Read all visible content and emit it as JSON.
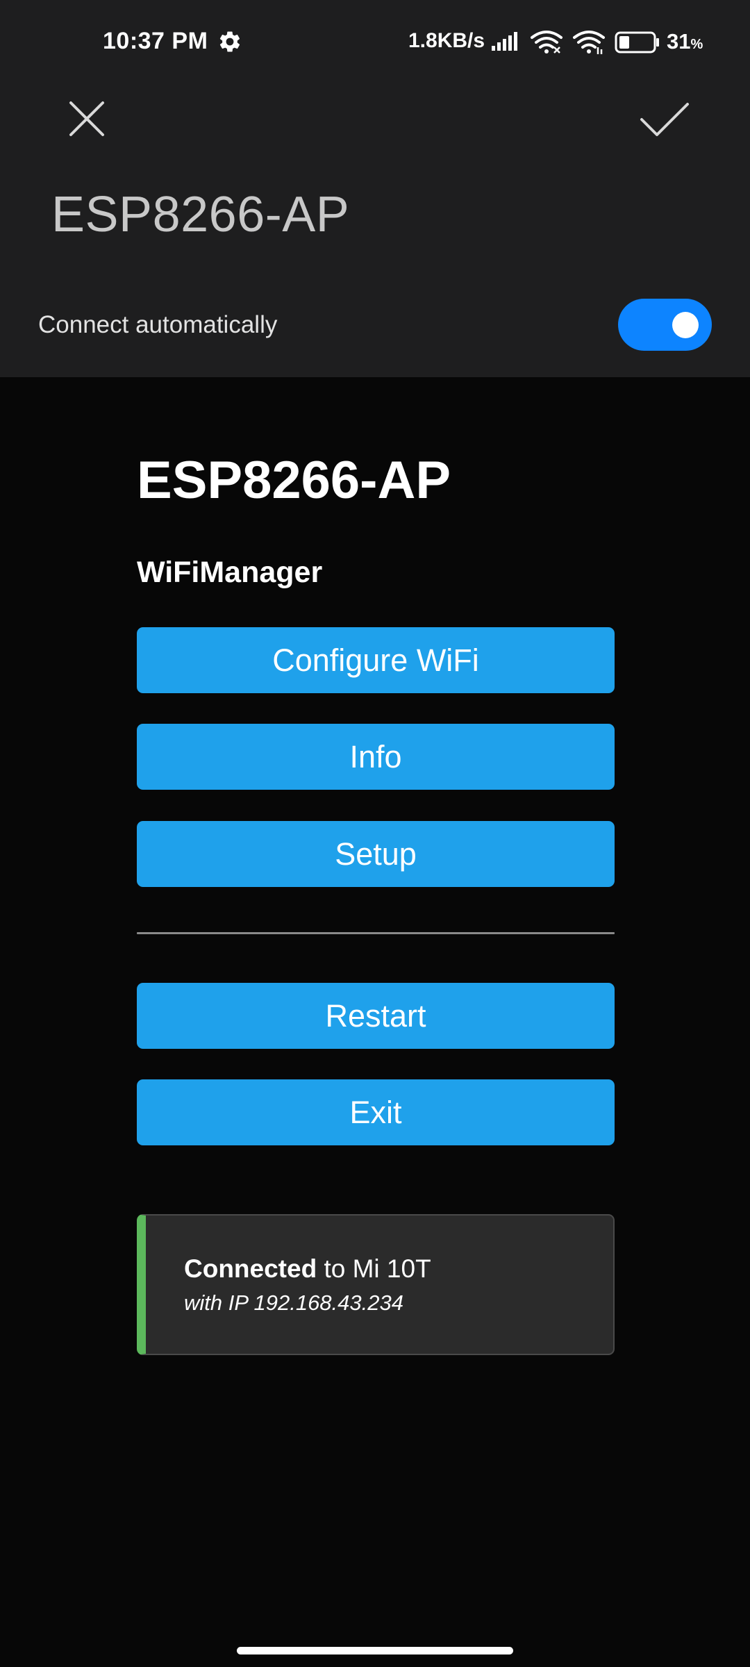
{
  "status_bar": {
    "time": "10:37 PM",
    "net_speed": "1.8KB/s",
    "battery_value": "31",
    "battery_unit": "%",
    "battery_level": 0.31,
    "icons": [
      "gear-icon",
      "signal-icon",
      "wifi-icon",
      "wifi-hotspot-icon",
      "battery-icon"
    ]
  },
  "dialog": {
    "network_name": "ESP8266-AP",
    "auto_connect_label": "Connect automatically",
    "auto_connect_enabled": true,
    "toggle_color": "#0d84ff"
  },
  "portal": {
    "title": "ESP8266-AP",
    "subtitle": "WiFiManager",
    "buttons": {
      "configure": "Configure WiFi",
      "info": "Info",
      "setup": "Setup",
      "restart": "Restart",
      "exit": "Exit"
    },
    "button_color": "#1fa1eb",
    "message": {
      "bold": "Connected",
      "rest": " to Mi 10T",
      "detail": "with IP 192.168.43.234",
      "accent_color": "#5cb85c"
    }
  }
}
